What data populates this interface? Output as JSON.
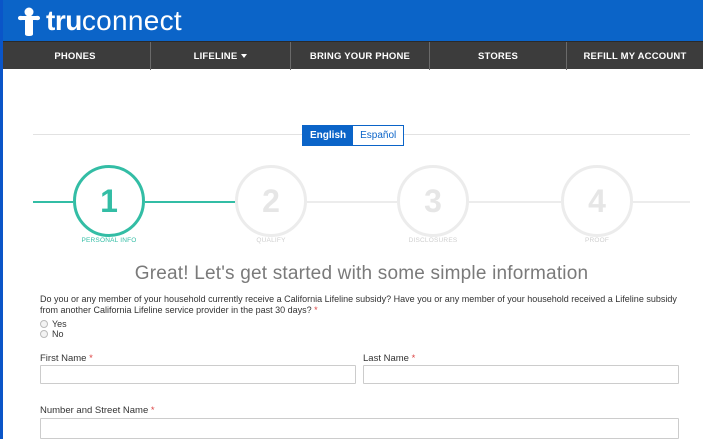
{
  "header": {
    "logo_tru": "tru",
    "logo_connect": "connect",
    "brand_color": "#0b64c8",
    "logo_icon": "person-icon"
  },
  "nav": {
    "items": [
      {
        "label": "PHONES"
      },
      {
        "label": "LIFELINE"
      },
      {
        "label": "BRING YOUR PHONE"
      },
      {
        "label": "STORES"
      },
      {
        "label": "REFILL MY ACCOUNT"
      }
    ]
  },
  "language": {
    "english": "English",
    "spanish": "Español",
    "selected": "English"
  },
  "steps": [
    {
      "number": "1",
      "label": "PERSONAL INFO",
      "active": true
    },
    {
      "number": "2",
      "label": "QUALIFY",
      "active": false
    },
    {
      "number": "3",
      "label": "DISCLOSURES",
      "active": false
    },
    {
      "number": "4",
      "label": "PROOF",
      "active": false
    }
  ],
  "accent_color": "#33bda5",
  "form": {
    "heading": "Great! Let's get started with some simple information",
    "question": "Do you or any member of your household currently receive a California Lifeline subsidy? Have you or any member of your household received a Lifeline subsidy from another California Lifeline service provider in the past 30 days?",
    "required_mark": "*",
    "options": [
      "Yes",
      "No"
    ],
    "first_name_label": "First Name",
    "last_name_label": "Last Name",
    "street_label": "Number and Street Name",
    "first_name_value": "",
    "last_name_value": "",
    "street_value": ""
  }
}
